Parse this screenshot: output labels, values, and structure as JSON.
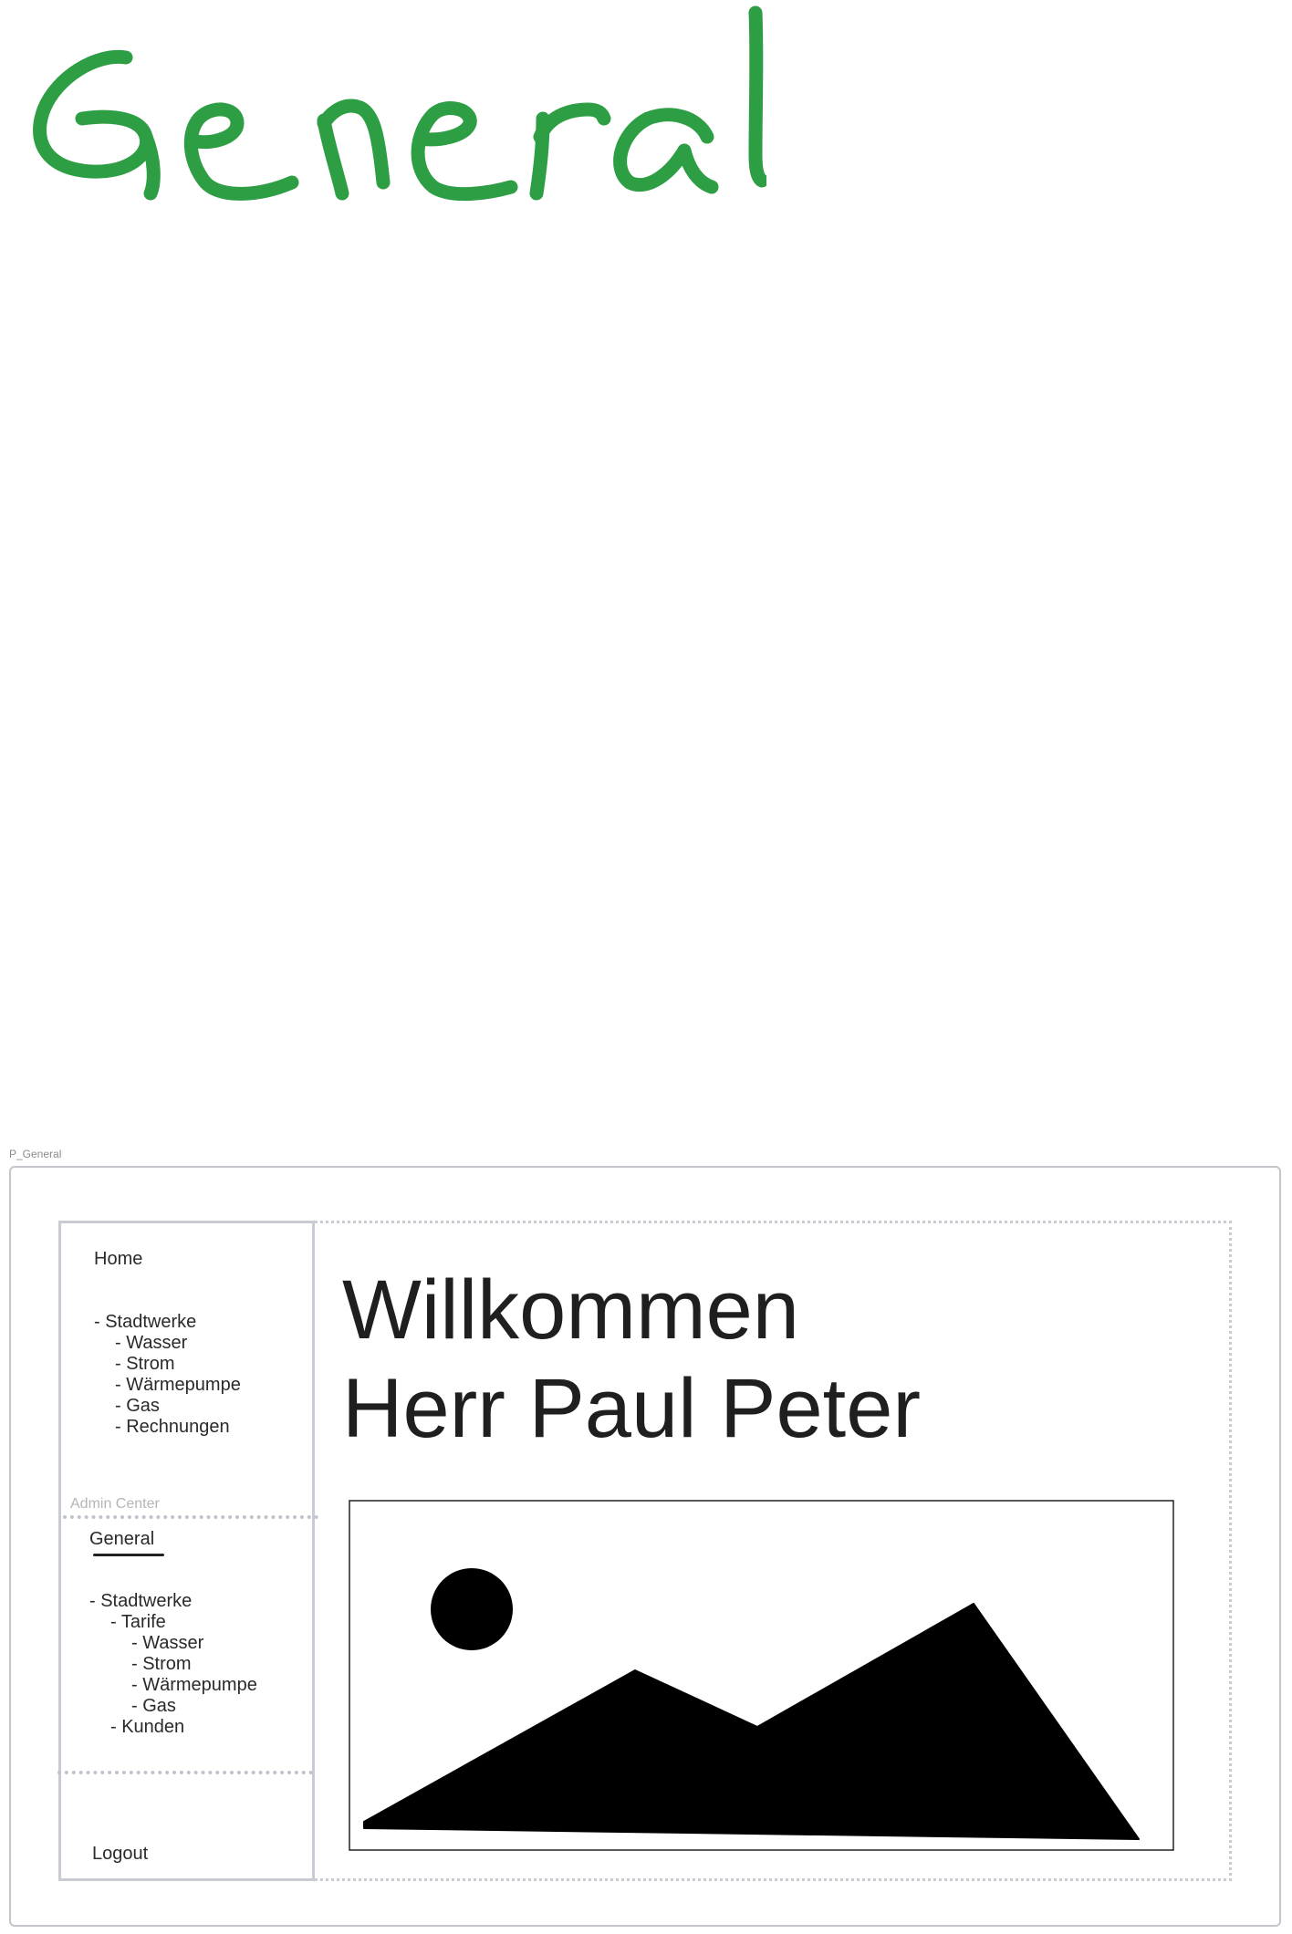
{
  "page": {
    "handwritten_title": "General",
    "frame_label": "P_General"
  },
  "sidebar": {
    "home": "Home",
    "user_items": [
      "- Stadtwerke",
      "- Wasser",
      "- Strom",
      "- Wärmepumpe",
      "- Gas",
      "- Rechnungen"
    ],
    "admin_label": "Admin Center",
    "general": "General",
    "admin_items": [
      "- Stadtwerke",
      "- Tarife",
      "- Wasser",
      "- Strom",
      "- Wärmepumpe",
      "- Gas",
      "- Kunden"
    ],
    "logout": "Logout"
  },
  "main": {
    "welcome_line1": "Willkommen",
    "welcome_line2": "Herr Paul Peter"
  },
  "colors": {
    "handwriting": "#2e9e44",
    "frame_border": "#c8ccd2",
    "text": "#222222"
  },
  "icons": {
    "image_placeholder": "image-placeholder-icon"
  }
}
